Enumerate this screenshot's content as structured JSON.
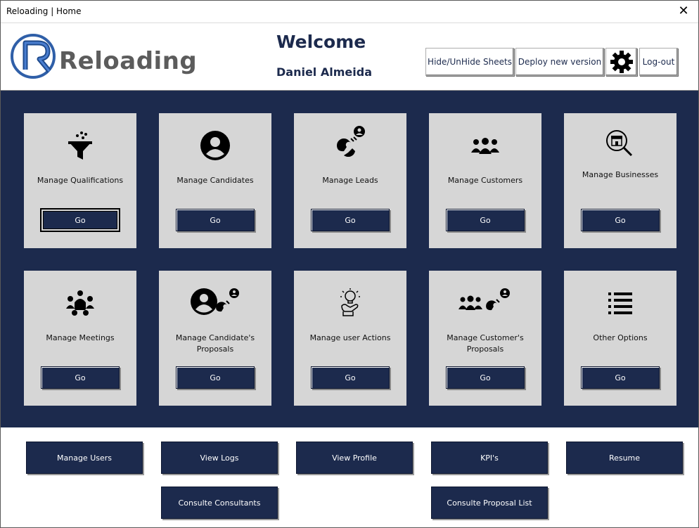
{
  "window": {
    "title": "Reloading | Home",
    "close_icon": "close-icon"
  },
  "header": {
    "logo_text": "Reloading",
    "welcome": "Welcome",
    "user_name": "Daniel Almeida",
    "buttons": {
      "hide_unhide": "Hide/UnHide Sheets",
      "deploy": "Deploy new version",
      "settings_icon": "gear-icon",
      "logout": "Log-out"
    }
  },
  "cards": [
    {
      "label": "Manage Qualifications",
      "go": "Go",
      "icon": "funnel-icon"
    },
    {
      "label": "Manage Candidates",
      "go": "Go",
      "icon": "user-circle-icon"
    },
    {
      "label": "Manage Leads",
      "go": "Go",
      "icon": "magnet-user-icon"
    },
    {
      "label": "Manage Customers",
      "go": "Go",
      "icon": "group-icon"
    },
    {
      "label": "Manage Businesses",
      "go": "Go",
      "icon": "store-search-icon"
    },
    {
      "label": "Manage Meetings",
      "go": "Go",
      "icon": "meeting-icon"
    },
    {
      "label": "Manage Candidate's Proposals",
      "go": "Go",
      "icon": "user-magnet-icon"
    },
    {
      "label": "Manage user Actions",
      "go": "Go",
      "icon": "hand-idea-icon"
    },
    {
      "label": "Manage Customer's Proposals",
      "go": "Go",
      "icon": "group-magnet-icon"
    },
    {
      "label": "Other Options",
      "go": "Go",
      "icon": "list-icon"
    }
  ],
  "bottom_buttons": {
    "manage_users": "Manage Users",
    "view_logs": "View Logs",
    "view_profile": "View Profile",
    "kpis": "KPI's",
    "resume": "Resume",
    "consultants": "Consulte Consultants",
    "proposal_list": "Consulte Proposal List"
  },
  "colors": {
    "navy": "#1c2a4d",
    "card": "#d6d6d6",
    "logo_blue": "#2f5fa8"
  }
}
